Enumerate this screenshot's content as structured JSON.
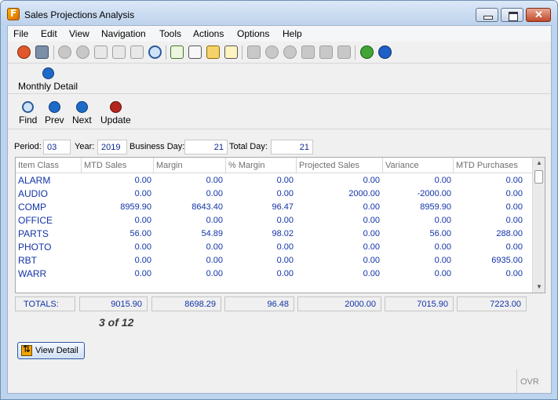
{
  "window": {
    "title": "Sales Projections Analysis",
    "colors": {
      "accent": "#1133a6",
      "frame": "#bcd4ee",
      "close": "#c0492b"
    }
  },
  "menu": [
    "File",
    "Edit",
    "View",
    "Navigation",
    "Tools",
    "Actions",
    "Options",
    "Help"
  ],
  "toolbar_icons": [
    "power-icon",
    "save-copy-icon",
    "check-icon",
    "cancel-icon",
    "copy-icon",
    "paste-icon",
    "select-all-icon",
    "zoom-icon",
    "notepad-icon",
    "attach-icon",
    "lock-doc-icon",
    "calendar-icon",
    "first-record-icon",
    "down-icon",
    "up-icon",
    "insert-row-icon",
    "delete-row-icon",
    "align-icon",
    "chart-icon",
    "help-icon"
  ],
  "ribbon": {
    "monthly_detail": "Monthly Detail"
  },
  "actions": {
    "find": "Find",
    "prev": "Prev",
    "next": "Next",
    "update": "Update"
  },
  "fields": {
    "period_label": "Period:",
    "period": "03",
    "year_label": "Year:",
    "year": "2019",
    "business_day_label": "Business Day:",
    "business_day": "21",
    "total_day_label": "Total Day:",
    "total_day": "21"
  },
  "grid": {
    "columns": [
      "Item Class",
      "MTD Sales",
      "Margin",
      "% Margin",
      "Projected Sales",
      "Variance",
      "MTD Purchases"
    ],
    "rows": [
      [
        "ALARM",
        "0.00",
        "0.00",
        "0.00",
        "0.00",
        "0.00",
        "0.00"
      ],
      [
        "AUDIO",
        "0.00",
        "0.00",
        "0.00",
        "2000.00",
        "-2000.00",
        "0.00"
      ],
      [
        "COMP",
        "8959.90",
        "8643.40",
        "96.47",
        "0.00",
        "8959.90",
        "0.00"
      ],
      [
        "OFFICE",
        "0.00",
        "0.00",
        "0.00",
        "0.00",
        "0.00",
        "0.00"
      ],
      [
        "PARTS",
        "56.00",
        "54.89",
        "98.02",
        "0.00",
        "56.00",
        "288.00"
      ],
      [
        "PHOTO",
        "0.00",
        "0.00",
        "0.00",
        "0.00",
        "0.00",
        "0.00"
      ],
      [
        "RBT",
        "0.00",
        "0.00",
        "0.00",
        "0.00",
        "0.00",
        "6935.00"
      ],
      [
        "WARR",
        "0.00",
        "0.00",
        "0.00",
        "0.00",
        "0.00",
        "0.00"
      ]
    ]
  },
  "totals": {
    "label": "TOTALS:",
    "values": [
      "9015.90",
      "8698.29",
      "96.48",
      "2000.00",
      "7015.90",
      "7223.00"
    ]
  },
  "page_indicator": "3 of 12",
  "view_detail_button": "View Detail",
  "status": {
    "ovr": "OVR"
  }
}
